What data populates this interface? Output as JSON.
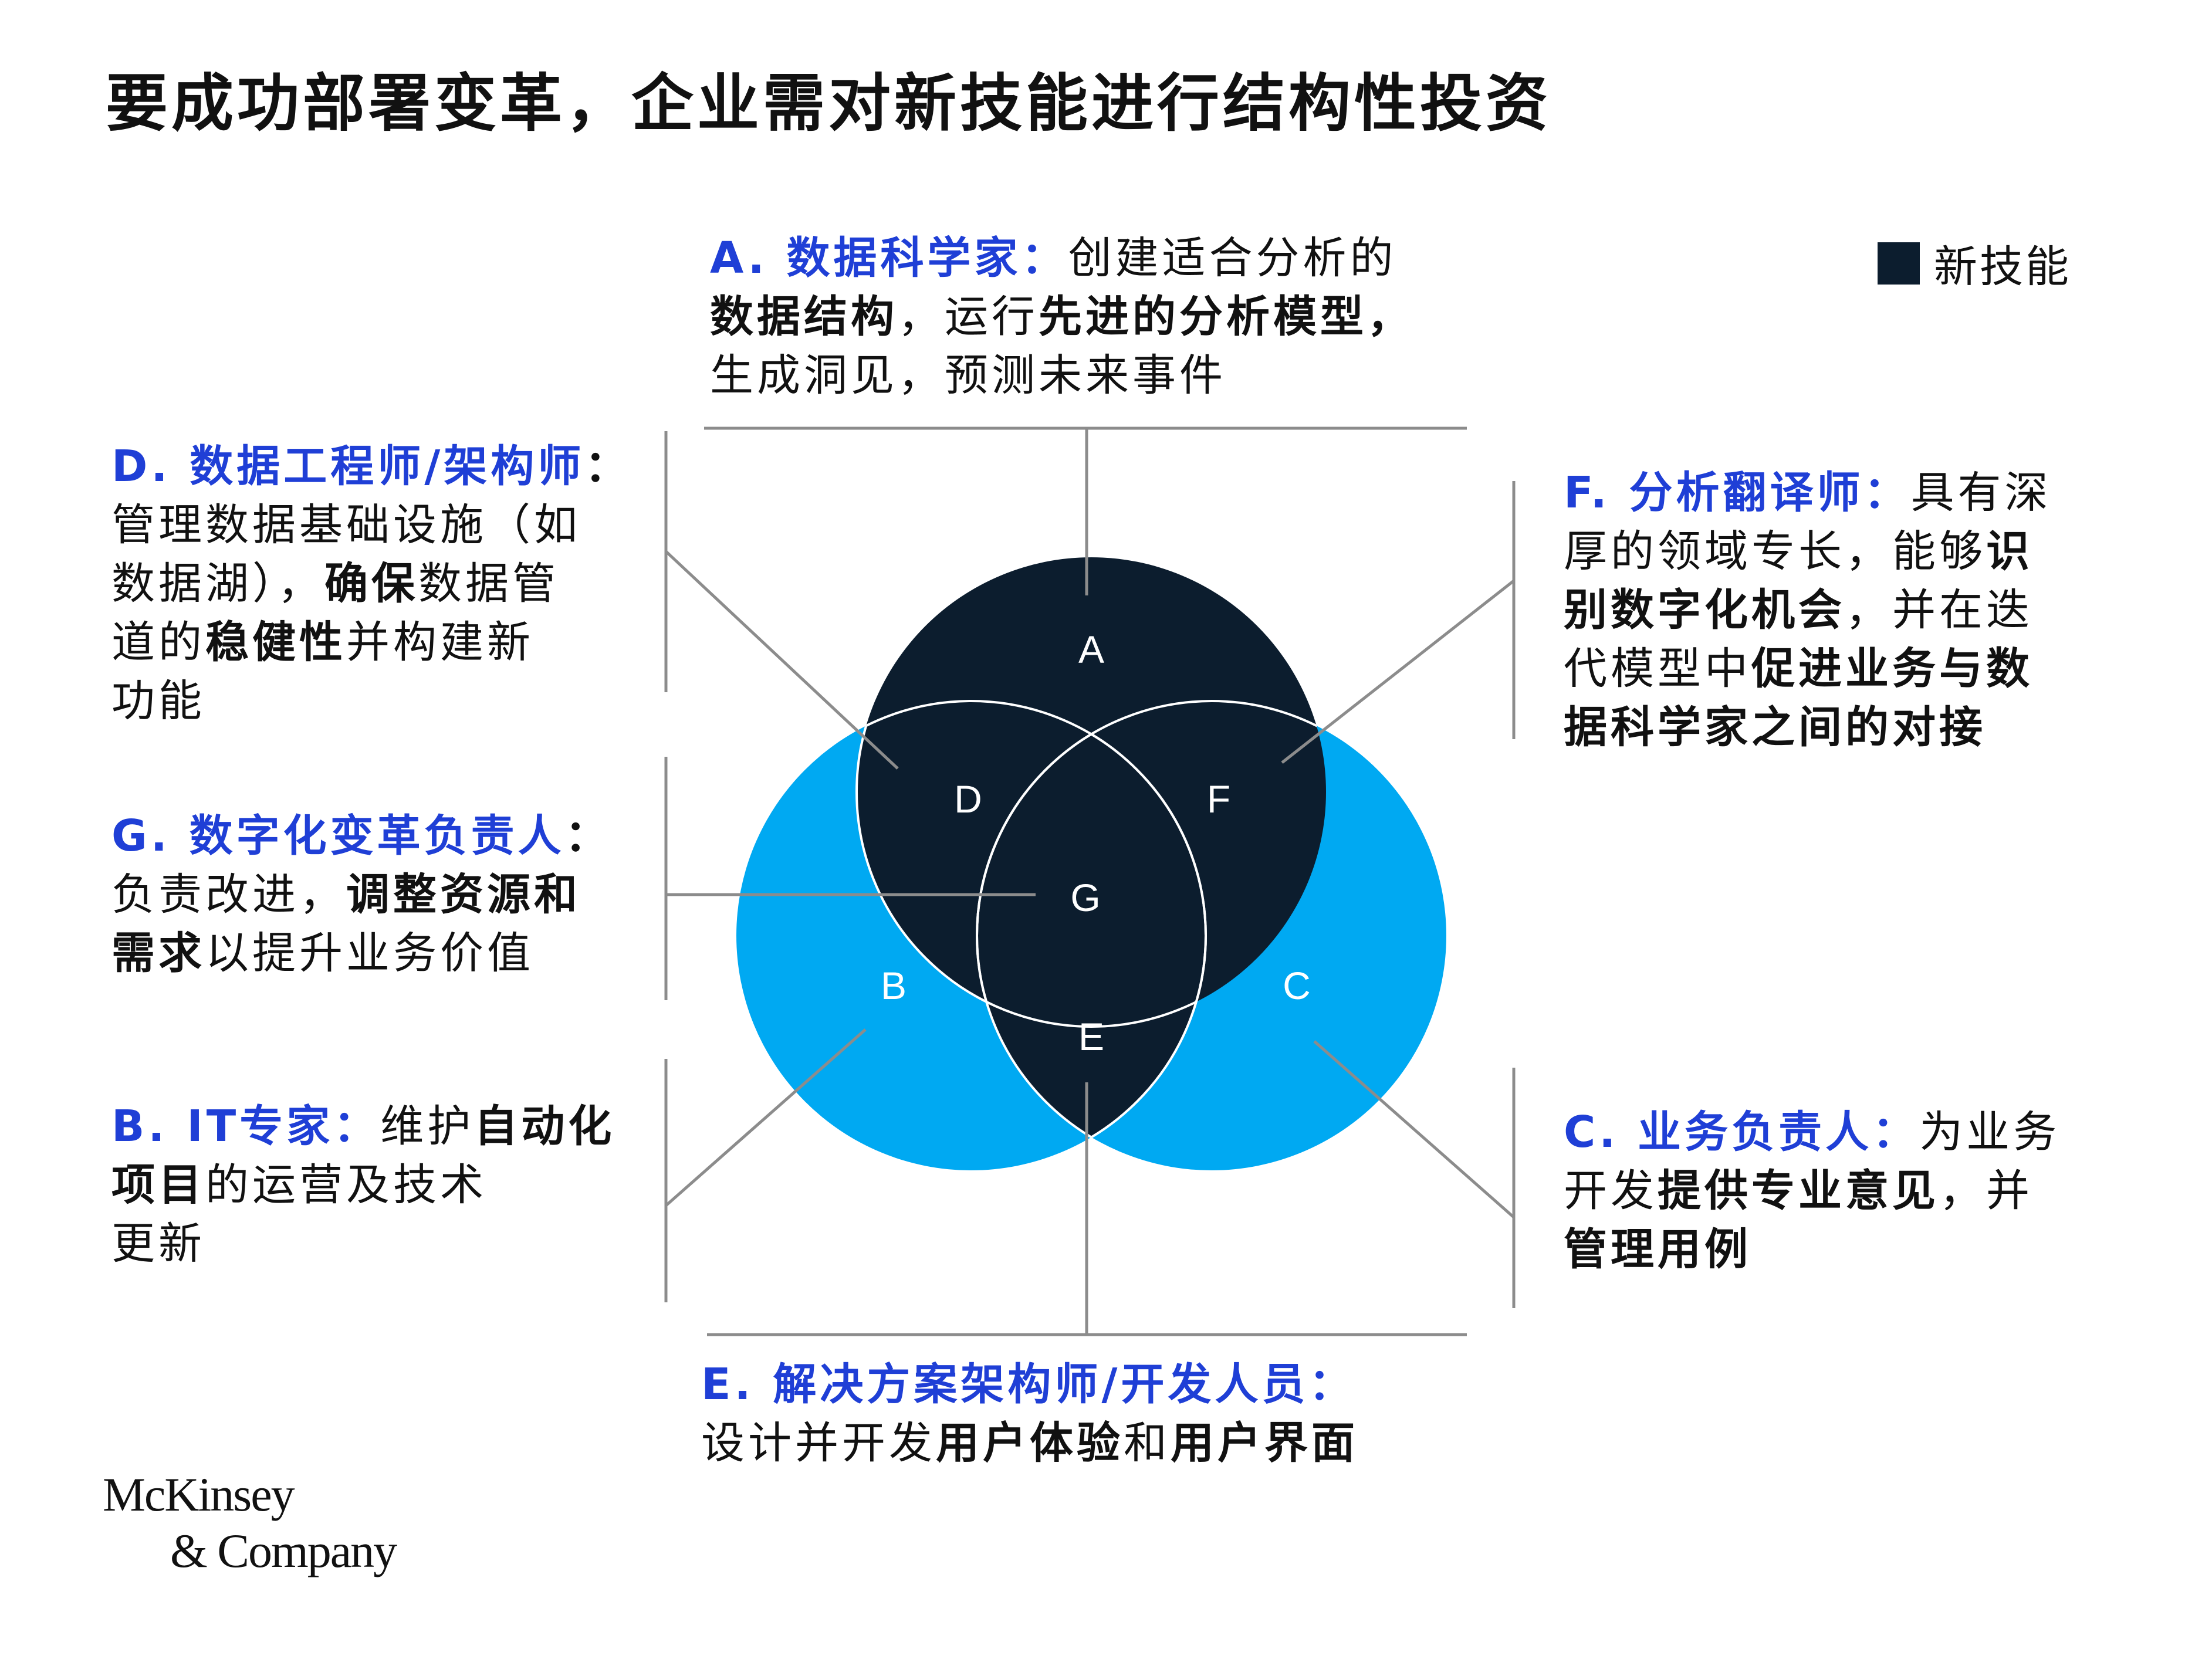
{
  "title": "要成功部署变革，企业需对新技能进行结构性投资",
  "legend": {
    "label": "新技能",
    "color": "#0c1d2e"
  },
  "colors": {
    "dark_navy": "#0c1d2e",
    "bright_blue": "#00a9f2",
    "heading_blue": "#1f3fd6",
    "line_gray": "#8c8c8c"
  },
  "regions": {
    "A": "A",
    "B": "B",
    "C": "C",
    "D": "D",
    "E": "E",
    "F": "F",
    "G": "G"
  },
  "roles": {
    "A": {
      "head": "A. 数据科学家：",
      "t1": "创建适合分析的",
      "b1": "数据结构",
      "t2": "，运行",
      "b2": "先进的分析模型，",
      "t3": "生成洞见，预测未来事件"
    },
    "D": {
      "head": "D. 数据工程师/架构师",
      "t1": "：",
      "t2": "管理数据基础设施（如",
      "t3": "数据湖），",
      "b1": "确保",
      "t4": "数据管",
      "t5": "道的",
      "b2": "稳健性",
      "t6": "并构建新",
      "t7": "功能"
    },
    "G": {
      "head": "G. 数字化变革负责人",
      "t1": "：",
      "t2": "负责改进，",
      "b1": "调整资源和",
      "b2": "需求",
      "t3": "以提升业务价值"
    },
    "B": {
      "head": "B. IT专家：",
      "t1": "维护",
      "b1": "自动化",
      "b2": "项目",
      "t2": "的运营及技术",
      "t3": "更新"
    },
    "F": {
      "head": "F. 分析翻译师：",
      "t1": "具有深",
      "t2": "厚的领域专长，能够",
      "b1": "识",
      "b2": "别数字化机会",
      "t3": "，并在迭",
      "t4": "代模型中",
      "b3": "促进业务与数",
      "b4": "据科学家之间的对接"
    },
    "C": {
      "head": "C. 业务负责人：",
      "t1": "为业务",
      "t2": "开发",
      "b1": "提供专业意见",
      "t3": "，并",
      "b2": "管理用例"
    },
    "E": {
      "head": "E. 解决方案架构师/开发人员：",
      "t1": "设计并开发",
      "b1": "用户体验",
      "t2": "和",
      "b2": "用户界面"
    }
  },
  "logo": {
    "line1": "McKinsey",
    "line2": "& Company"
  }
}
